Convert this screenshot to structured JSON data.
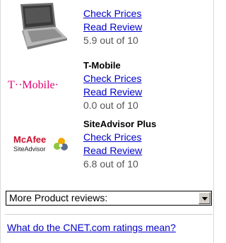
{
  "products": [
    {
      "name": "",
      "thumb_icon": "laptop-icon",
      "check_prices": "Check Prices",
      "read_review": "Read Review",
      "rating": "5.9 out of 10"
    },
    {
      "name": "T-Mobile",
      "thumb_icon": "tmobile-logo",
      "logo_text": "T··Mobile·",
      "check_prices": "Check Prices",
      "read_review": "Read Review",
      "rating": "0.0 out of 10"
    },
    {
      "name": "SiteAdvisor Plus",
      "thumb_icon": "mcafee-logo",
      "logo_text_1": "McAfee",
      "logo_text_2": "SiteAdvisor",
      "check_prices": "Check Prices",
      "read_review": "Read Review",
      "rating": "6.8 out of 10"
    }
  ],
  "more_reviews": {
    "selected": "More Product reviews:"
  },
  "footer": {
    "link": "What do the CNET.com ratings mean?"
  },
  "colors": {
    "link": "#0000cc",
    "tmobile": "#e20074",
    "mcafee": "#c8102e"
  }
}
